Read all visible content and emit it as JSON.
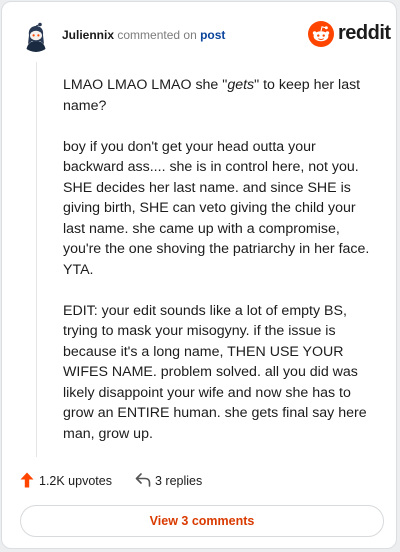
{
  "header": {
    "username": "Juliennix",
    "action_text": "commented on",
    "post_link": "post",
    "brand": "reddit"
  },
  "comment": {
    "p1_before": "LMAO LMAO LMAO she \"",
    "p1_emph": "gets",
    "p1_after": "\" to keep her last name?",
    "p2": "boy if you don't get your head outta your backward ass.... she is in control here, not you. SHE decides her last name. and since SHE is giving birth, SHE can veto giving the child your last name. she came up with a compromise, you're the one shoving the patriarchy in her face. YTA.",
    "p3": "EDIT: your edit sounds like a lot of empty BS, trying to mask your misogyny. if the issue is because it's a long name, THEN USE YOUR WIFES NAME. problem solved. all you did was likely disappoint your wife and now she has to grow an ENTIRE human. she gets final say here man, grow up."
  },
  "actions": {
    "upvotes": "1.2K upvotes",
    "replies": "3 replies"
  },
  "view_button": "View 3 comments",
  "colors": {
    "accent": "#ff4500",
    "view_button_text": "#d93a00",
    "post_link": "#0a449b"
  },
  "icons": {
    "avatar": "avatar-snoo-icon",
    "brand": "reddit-logo-icon",
    "upvote": "upvote-arrow-icon",
    "reply": "reply-arrow-icon"
  }
}
